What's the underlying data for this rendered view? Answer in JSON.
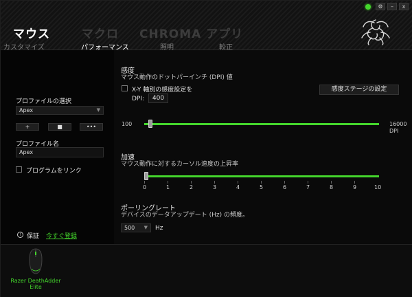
{
  "window": {
    "status_color": "#44d62c",
    "controls": [
      "⚙",
      "–",
      "x"
    ]
  },
  "tabs": {
    "main": [
      {
        "label": "マウス",
        "active": true
      },
      {
        "label": "マクロ",
        "active": false
      },
      {
        "label": "CHROMA アプリ",
        "active": false
      }
    ],
    "sub": [
      {
        "label": "カスタマイズ",
        "active": false
      },
      {
        "label": "パフォーマンス",
        "active": true
      },
      {
        "label": "照明",
        "active": false
      },
      {
        "label": "較正",
        "active": false
      }
    ]
  },
  "left": {
    "profile_select_label": "プロファイルの選択",
    "profile_selected": "Apex",
    "buttons": [
      "+",
      "■",
      "•••"
    ],
    "profile_name_label": "プロファイル名",
    "profile_name_value": "Apex",
    "link_program_label": "プログラムをリンク",
    "warranty_label": "保証",
    "register_link": "今すぐ登録"
  },
  "sensitivity": {
    "title": "感度",
    "subtitle": "マウス動作のドットパーインチ (DPI) 値",
    "xy_label": "X-Y 軸別の感度設定を",
    "dpi_label": "DPI:",
    "dpi_value": "400",
    "stage_button": "感度ステージの設定",
    "min_label": "100",
    "max_label": "16000",
    "unit_label": "DPI",
    "min": 100,
    "max": 16000,
    "value": 400
  },
  "acceleration": {
    "title": "加速",
    "subtitle": "マウス動作に対するカーソル速度の上昇率",
    "ticks": [
      "0",
      "1",
      "2",
      "3",
      "4",
      "5",
      "6",
      "7",
      "8",
      "9",
      "10"
    ],
    "value": 0
  },
  "polling": {
    "title": "ポーリングレート",
    "subtitle": "デバイスのデータアップデート (Hz) の頻度。",
    "value": "500",
    "unit": "Hz"
  },
  "device": {
    "name_line1": "Razer DeathAdder",
    "name_line2": "Elite"
  },
  "colors": {
    "accent": "#44d62c",
    "background": "#0a0a0a"
  }
}
